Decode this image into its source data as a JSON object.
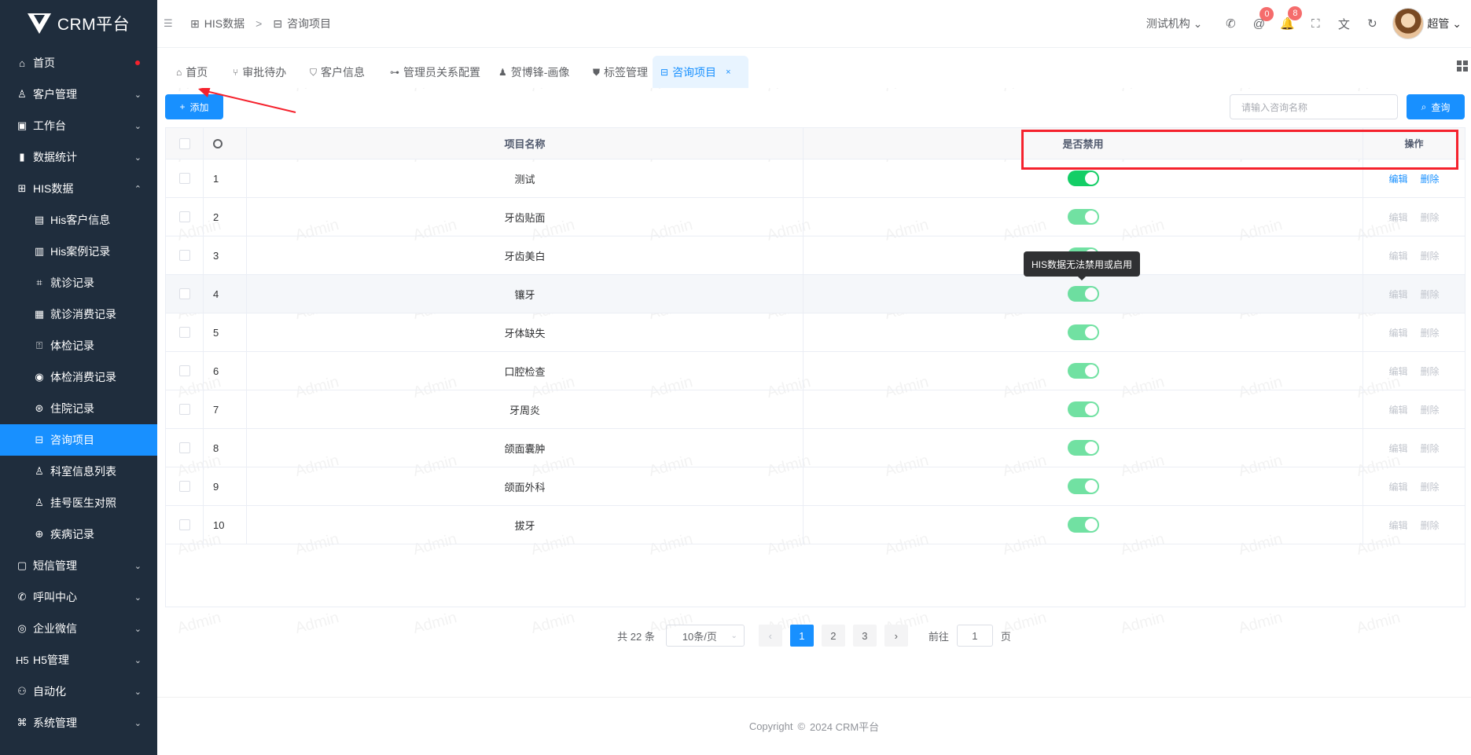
{
  "app": {
    "title": "CRM平台"
  },
  "sidebar": {
    "items": [
      {
        "label": "首页",
        "icon": "home-icon",
        "glyph": "⌂",
        "expand": ""
      },
      {
        "label": "客户管理",
        "icon": "user-icon",
        "glyph": "♙",
        "expand": "⌄"
      },
      {
        "label": "工作台",
        "icon": "briefcase-icon",
        "glyph": "▣",
        "expand": "⌄"
      },
      {
        "label": "数据统计",
        "icon": "bar-chart-icon",
        "glyph": "▮",
        "expand": "⌄"
      },
      {
        "label": "HIS数据",
        "icon": "hospital-icon",
        "glyph": "⊞",
        "expand": "⌃"
      },
      {
        "label": "His客户信息",
        "icon": "id-card-icon",
        "glyph": "▤"
      },
      {
        "label": "His案例记录",
        "icon": "document-icon",
        "glyph": "▥"
      },
      {
        "label": "就诊记录",
        "icon": "scan-icon",
        "glyph": "⌗"
      },
      {
        "label": "就诊消费记录",
        "icon": "receipt-icon",
        "glyph": "▦"
      },
      {
        "label": "体检记录",
        "icon": "clipboard-icon",
        "glyph": "⍐"
      },
      {
        "label": "体检消费记录",
        "icon": "coin-icon",
        "glyph": "◉"
      },
      {
        "label": "住院记录",
        "icon": "bed-icon",
        "glyph": "⊛"
      },
      {
        "label": "咨询项目",
        "icon": "archive-icon",
        "glyph": "⊟"
      },
      {
        "label": "科室信息列表",
        "icon": "user-search-icon",
        "glyph": "♙"
      },
      {
        "label": "挂号医生对照",
        "icon": "doctor-icon",
        "glyph": "♙"
      },
      {
        "label": "疾病记录",
        "icon": "medical-kit-icon",
        "glyph": "⊕"
      },
      {
        "label": "短信管理",
        "icon": "message-icon",
        "glyph": "▢",
        "expand": "⌄"
      },
      {
        "label": "呼叫中心",
        "icon": "phone-icon",
        "glyph": "✆",
        "expand": "⌄"
      },
      {
        "label": "企业微信",
        "icon": "wechat-icon",
        "glyph": "◎",
        "expand": "⌄"
      },
      {
        "label": "H5管理",
        "icon": "h5-icon",
        "glyph": "H5",
        "expand": "⌄"
      },
      {
        "label": "自动化",
        "icon": "share-icon",
        "glyph": "⚇",
        "expand": "⌄"
      },
      {
        "label": "系统管理",
        "icon": "command-icon",
        "glyph": "⌘",
        "expand": "⌄"
      }
    ]
  },
  "header": {
    "fold_glyph": "☰",
    "breadcrumb": [
      "HIS数据",
      "咨询项目"
    ],
    "breadcrumb_sep": ">",
    "org_select": "测试机构",
    "org_caret": "⌄",
    "icons": [
      {
        "name": "phone-icon",
        "glyph": "✆",
        "badge": ""
      },
      {
        "name": "at-icon",
        "glyph": "@",
        "badge": "0"
      },
      {
        "name": "bell-icon",
        "glyph": "🔔",
        "badge": "8"
      },
      {
        "name": "fullscreen-icon",
        "glyph": "⛶",
        "badge": ""
      },
      {
        "name": "translate-icon",
        "glyph": "文",
        "badge": ""
      },
      {
        "name": "refresh-icon",
        "glyph": "↻",
        "badge": ""
      }
    ],
    "user_name": "超管",
    "user_caret": "⌄"
  },
  "tabs": [
    {
      "label": "首页",
      "icon": "home-icon",
      "glyph": "⌂"
    },
    {
      "label": "审批待办",
      "icon": "branch-icon",
      "glyph": "⑂"
    },
    {
      "label": "客户信息",
      "icon": "shield-icon",
      "glyph": "⛉"
    },
    {
      "label": "管理员关系配置",
      "icon": "relation-icon",
      "glyph": "⊶"
    },
    {
      "label": "贺博锋-画像",
      "icon": "person-icon",
      "glyph": "♟"
    },
    {
      "label": "标签管理",
      "icon": "tag-shield-icon",
      "glyph": "⛊"
    },
    {
      "label": "咨询项目",
      "icon": "archive-icon",
      "glyph": "⊟",
      "close": "×"
    }
  ],
  "toolbar": {
    "add_label": "添加",
    "add_glyph": "+",
    "search_placeholder": "请输入咨询名称",
    "search_label": "查询",
    "search_glyph": "⌕"
  },
  "watermark_text": "Admin",
  "table": {
    "headers": {
      "name": "项目名称",
      "disabled": "是否禁用",
      "ops": "操作"
    },
    "rows": [
      {
        "idx": "1",
        "name": "测试",
        "enabled": true,
        "editable": true
      },
      {
        "idx": "2",
        "name": "牙齿贴面",
        "enabled": true,
        "editable": false
      },
      {
        "idx": "3",
        "name": "牙齿美白",
        "enabled": true,
        "editable": false
      },
      {
        "idx": "4",
        "name": "镶牙",
        "enabled": true,
        "editable": false
      },
      {
        "idx": "5",
        "name": "牙体缺失",
        "enabled": true,
        "editable": false
      },
      {
        "idx": "6",
        "name": "口腔检查",
        "enabled": true,
        "editable": false
      },
      {
        "idx": "7",
        "name": "牙周炎",
        "enabled": true,
        "editable": false
      },
      {
        "idx": "8",
        "name": "颌面囊肿",
        "enabled": true,
        "editable": false
      },
      {
        "idx": "9",
        "name": "颌面外科",
        "enabled": true,
        "editable": false
      },
      {
        "idx": "10",
        "name": "拔牙",
        "enabled": true,
        "editable": false
      }
    ],
    "edit_label": "编辑",
    "delete_label": "删除",
    "tooltip": "HIS数据无法禁用或启用"
  },
  "pagination": {
    "total_text": "共 22 条",
    "page_size": "10条/页",
    "pages": [
      "1",
      "2",
      "3"
    ],
    "current": "1",
    "prev_glyph": "‹",
    "next_glyph": "›",
    "size_caret": "⌄",
    "goto_prefix": "前往",
    "goto_value": "1",
    "goto_suffix": "页"
  },
  "footer": {
    "copyright": "Copyright",
    "copy_glyph": "©",
    "text": "2024 CRM平台"
  },
  "colors": {
    "primary": "#1890ff",
    "sidebar_bg": "#1f2d3d",
    "switch_on": "#13ce66",
    "highlight": "#f5222d"
  }
}
